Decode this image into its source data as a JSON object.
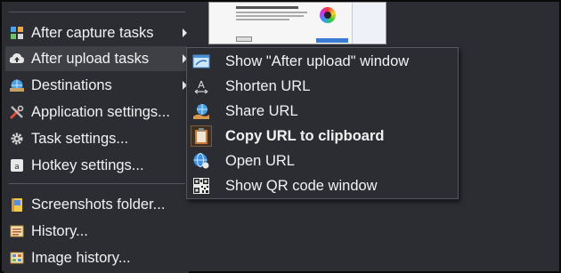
{
  "main_menu": {
    "items": [
      {
        "label": "After capture tasks",
        "icon": "grid-icon",
        "has_submenu": true
      },
      {
        "label": "After upload tasks",
        "icon": "cloud-upload-icon",
        "has_submenu": true,
        "active": true
      },
      {
        "label": "Destinations",
        "icon": "globe-upload-icon",
        "has_submenu": true
      },
      {
        "label": "Application settings...",
        "icon": "tools-icon",
        "has_submenu": false
      },
      {
        "label": "Task settings...",
        "icon": "gear-icon",
        "has_submenu": false
      },
      {
        "label": "Hotkey settings...",
        "icon": "keyboard-icon",
        "has_submenu": false
      },
      {
        "label": "Screenshots folder...",
        "icon": "folder-icon",
        "has_submenu": false
      },
      {
        "label": "History...",
        "icon": "history-icon",
        "has_submenu": false
      },
      {
        "label": "Image history...",
        "icon": "image-history-icon",
        "has_submenu": false
      }
    ]
  },
  "submenu": {
    "items": [
      {
        "label": "Show \"After upload\" window",
        "icon": "window-icon",
        "checked": false
      },
      {
        "label": "Shorten URL",
        "icon": "shorten-url-icon",
        "checked": false
      },
      {
        "label": "Share URL",
        "icon": "share-url-icon",
        "checked": false
      },
      {
        "label": "Copy URL to clipboard",
        "icon": "clipboard-icon",
        "checked": true
      },
      {
        "label": "Open URL",
        "icon": "globe-icon",
        "checked": false
      },
      {
        "label": "Show QR code window",
        "icon": "qr-code-icon",
        "checked": false
      }
    ]
  },
  "colors": {
    "menu_bg": "#2b2d33",
    "menu_text": "#f2f2f2",
    "separator": "#55585e",
    "active_bg": "#3e4046"
  }
}
